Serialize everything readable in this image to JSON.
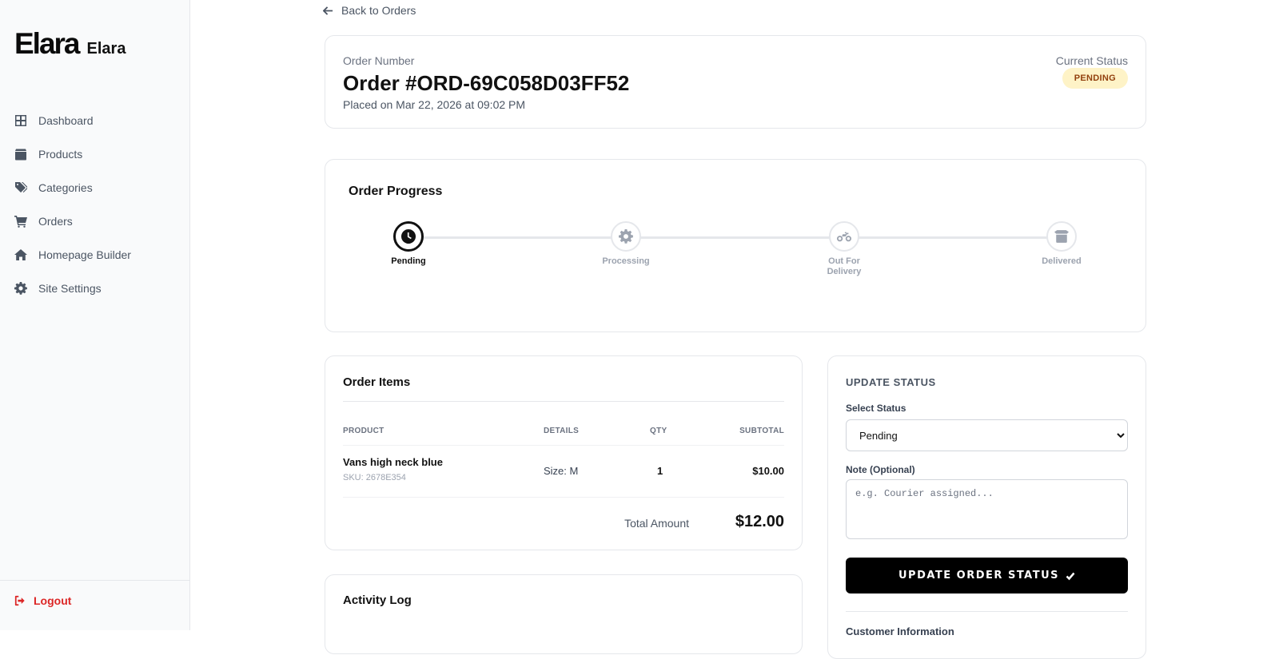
{
  "sidebar": {
    "logo_text": "Elara",
    "brand_name": "Elara",
    "items": [
      {
        "label": "Dashboard",
        "icon": "grid-icon"
      },
      {
        "label": "Products",
        "icon": "box-icon"
      },
      {
        "label": "Categories",
        "icon": "tags-icon"
      },
      {
        "label": "Orders",
        "icon": "cart-icon"
      },
      {
        "label": "Homepage Builder",
        "icon": "home-icon"
      },
      {
        "label": "Site Settings",
        "icon": "gear-icon"
      }
    ],
    "logout_label": "Logout"
  },
  "back_link": "Back to Orders",
  "order": {
    "number_label": "Order Number",
    "title": "Order #ORD-69C058D03FF52",
    "placed": "Placed on Mar 22, 2026 at 09:02 PM",
    "current_status_label": "Current Status",
    "status_badge": "PENDING"
  },
  "progress": {
    "title": "Order Progress",
    "steps": [
      {
        "label": "Pending",
        "icon": "clock-icon",
        "active": true
      },
      {
        "label": "Processing",
        "icon": "gear-icon",
        "active": false
      },
      {
        "label": "Out For Delivery",
        "icon": "motorcycle-icon",
        "active": false
      },
      {
        "label": "Delivered",
        "icon": "package-icon",
        "active": false
      }
    ]
  },
  "items": {
    "title": "Order Items",
    "headers": {
      "product": "PRODUCT",
      "details": "DETAILS",
      "qty": "QTY",
      "subtotal": "SUBTOTAL"
    },
    "rows": [
      {
        "name": "Vans high neck blue",
        "sku": "SKU: 2678E354",
        "details": "Size: M",
        "qty": "1",
        "subtotal": "$10.00"
      }
    ],
    "total_label": "Total Amount",
    "total_value": "$12.00"
  },
  "activity": {
    "title": "Activity Log"
  },
  "update": {
    "title": "UPDATE STATUS",
    "select_label": "Select Status",
    "selected_value": "Pending",
    "note_label": "Note (Optional)",
    "note_placeholder": "e.g. Courier assigned...",
    "button_label": "UPDATE ORDER STATUS",
    "customer_info_label": "Customer Information"
  },
  "colors": {
    "badge_bg": "#fef3c7",
    "badge_text": "#92400e",
    "logout": "#dc2626",
    "button_bg": "#000000"
  }
}
